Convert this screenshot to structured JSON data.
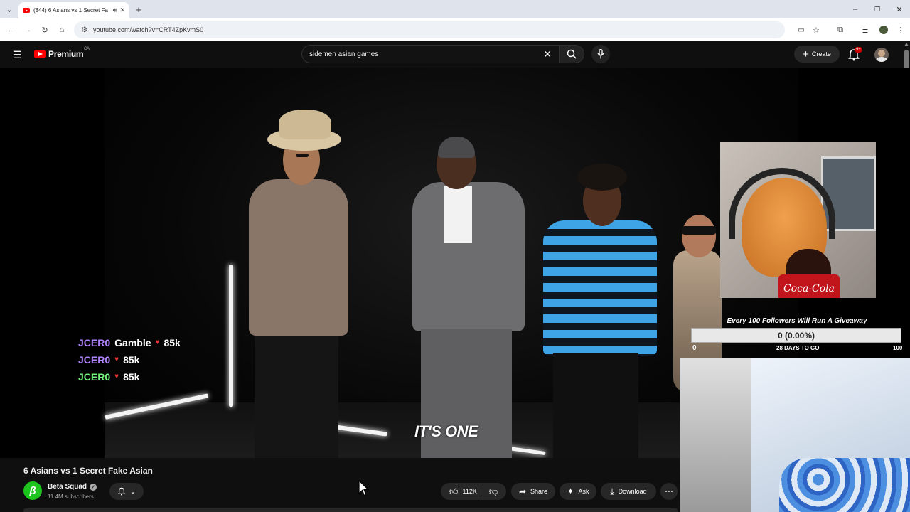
{
  "browser": {
    "tab_title": "(844) 6 Asians vs 1 Secret Fa",
    "url": "youtube.com/watch?v=CRT4ZpKvmS0"
  },
  "youtube": {
    "logo_text": "Premium",
    "region": "CA",
    "search_query": "sidemen asian games",
    "create_label": "Create",
    "notification_count": "9+"
  },
  "overlay": {
    "ticker": [
      {
        "user": "JCER0",
        "game": "Gamble",
        "amount": "85k"
      },
      {
        "user": "JCER0",
        "game": "",
        "amount": "85k"
      },
      {
        "user": "JCER0",
        "game": "",
        "amount": "85k"
      }
    ],
    "caption": "IT'S ONE",
    "goal": {
      "title": "Every 100 Followers Will Run A Giveaway",
      "progress_text": "0 (0.00%)",
      "progress_fraction": 0.0,
      "min": "0",
      "days_left": "28 DAYS TO GO",
      "max": "100"
    },
    "bottle_text": "Coca-Cola"
  },
  "video": {
    "title": "6 Asians vs 1 Secret Fake Asian",
    "channel_name": "Beta Squad",
    "channel_initial": "β",
    "subscribers": "11.4M subscribers",
    "likes": "112K",
    "share_label": "Share",
    "ask_label": "Ask",
    "download_label": "Download"
  }
}
